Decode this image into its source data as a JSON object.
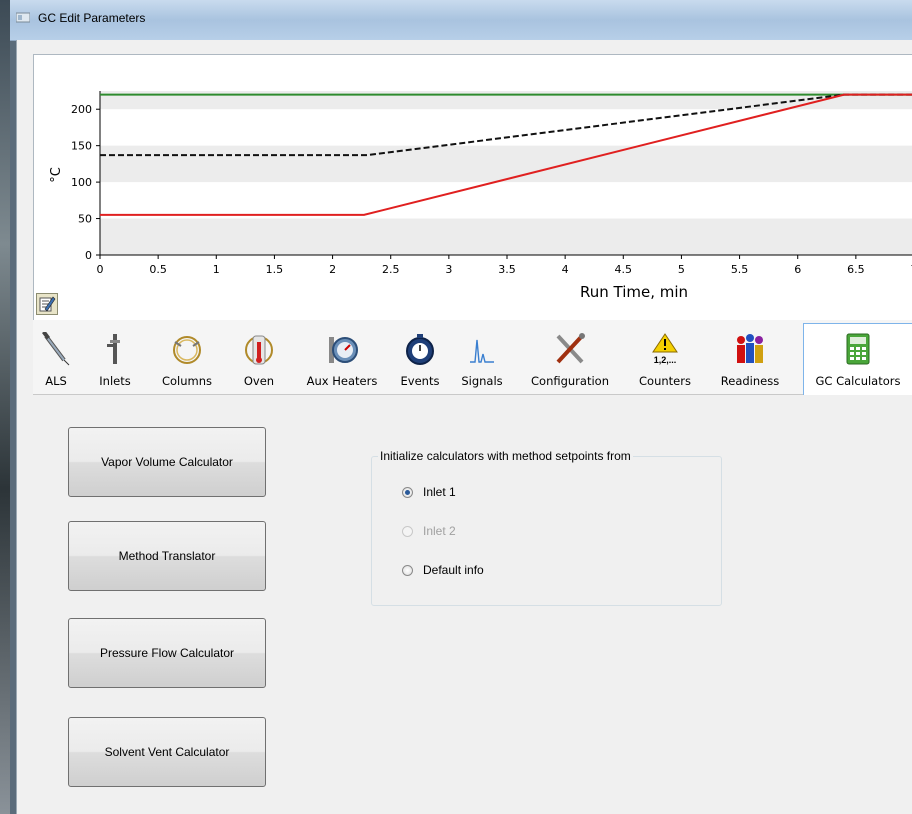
{
  "window": {
    "title": "GC Edit Parameters"
  },
  "chart_data": {
    "type": "line",
    "ylabel": "°C",
    "xlabel": "Run Time, min",
    "xlim": [
      0,
      7
    ],
    "ylim": [
      0,
      225
    ],
    "x_ticks": [
      "0",
      "0.5",
      "1",
      "1.5",
      "2",
      "2.5",
      "3",
      "3.5",
      "4",
      "4.5",
      "5",
      "5.5",
      "6",
      "6.5",
      "7"
    ],
    "y_ticks": [
      "0",
      "50",
      "100",
      "150",
      "200"
    ],
    "bands": "alternating light-gray horizontal bands",
    "series": [
      {
        "color": "#2e8b2e",
        "style": "solid",
        "points": [
          [
            0,
            220
          ],
          [
            7,
            220
          ]
        ]
      },
      {
        "color": "#111111",
        "style": "dashed",
        "points": [
          [
            0,
            137
          ],
          [
            2.3,
            137
          ],
          [
            6.4,
            220
          ],
          [
            7,
            220
          ]
        ]
      },
      {
        "color": "#e02020",
        "style": "solid",
        "points": [
          [
            0,
            55
          ],
          [
            2.27,
            55
          ],
          [
            6.4,
            220
          ],
          [
            7,
            220
          ]
        ]
      }
    ]
  },
  "toolbar": {
    "items": [
      {
        "label": "ALS",
        "icon": "syringe-icon"
      },
      {
        "label": "Inlets",
        "icon": "inlet-icon"
      },
      {
        "label": "Columns",
        "icon": "column-coil-icon"
      },
      {
        "label": "Oven",
        "icon": "oven-icon"
      },
      {
        "label": "Aux Heaters",
        "icon": "gauge-icon"
      },
      {
        "label": "Events",
        "icon": "stopwatch-icon"
      },
      {
        "label": "Signals",
        "icon": "signal-peak-icon"
      },
      {
        "label": "Configuration",
        "icon": "tools-icon"
      },
      {
        "label": "Counters",
        "icon": "warning-counter-icon",
        "icon_text": "1,2,..."
      },
      {
        "label": "Readiness",
        "icon": "readiness-icon"
      },
      {
        "label": "GC Calculators",
        "icon": "calculator-icon",
        "selected": true
      }
    ]
  },
  "calculators": {
    "buttons": [
      "Vapor Volume Calculator",
      "Method Translator",
      "Pressure Flow Calculator",
      "Solvent Vent Calculator"
    ],
    "group_title": "Initialize calculators with method setpoints from",
    "options": [
      {
        "label": "Inlet 1",
        "selected": true,
        "enabled": true
      },
      {
        "label": "Inlet 2",
        "selected": false,
        "enabled": false
      },
      {
        "label": "Default info",
        "selected": false,
        "enabled": true
      }
    ]
  }
}
